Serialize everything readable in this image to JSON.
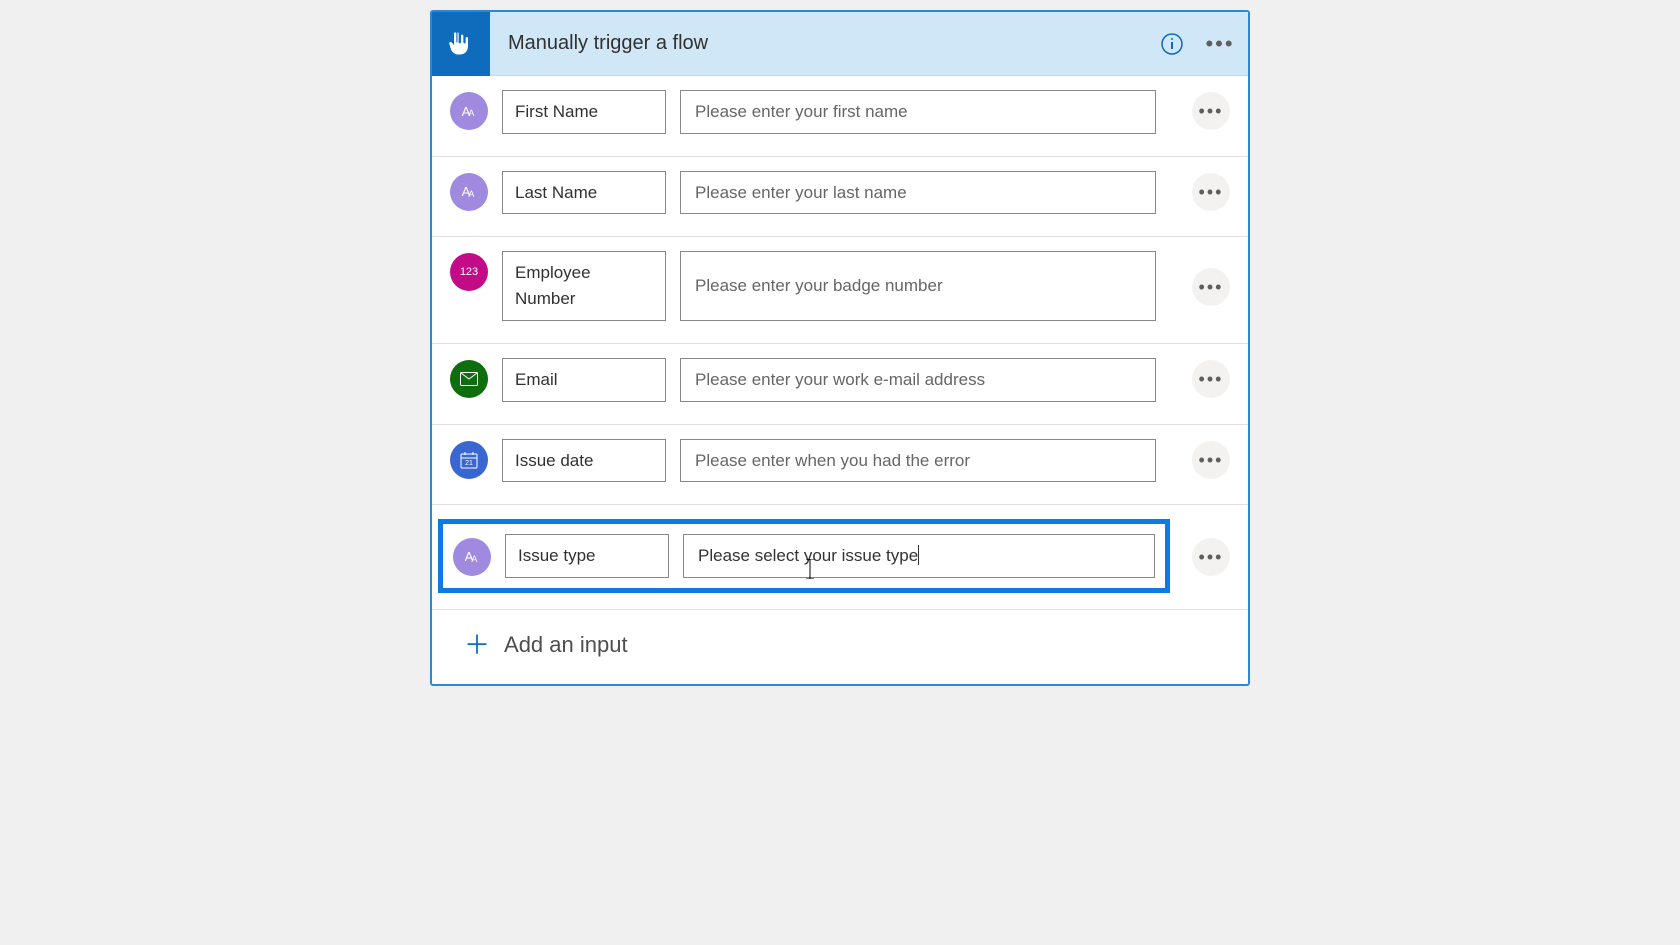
{
  "header": {
    "title": "Manually trigger a flow"
  },
  "rows": [
    {
      "icon": "text",
      "label": "First Name",
      "placeholder": "Please enter your first name"
    },
    {
      "icon": "text",
      "label": "Last Name",
      "placeholder": "Please enter your last name"
    },
    {
      "icon": "number",
      "label": "Employee Number",
      "placeholder": "Please enter your badge number"
    },
    {
      "icon": "email",
      "label": "Email",
      "placeholder": "Please enter your work e-mail address"
    },
    {
      "icon": "date",
      "label": "Issue date",
      "placeholder": "Please enter when you had the error"
    },
    {
      "icon": "text",
      "label": "Issue type",
      "placeholder": "Please select your issue type",
      "highlighted": true,
      "active": true
    }
  ],
  "addInput": {
    "label": "Add an input"
  },
  "iconGlyphs": {
    "text": "aA",
    "number": "123",
    "email": "✉",
    "date": "📅"
  }
}
